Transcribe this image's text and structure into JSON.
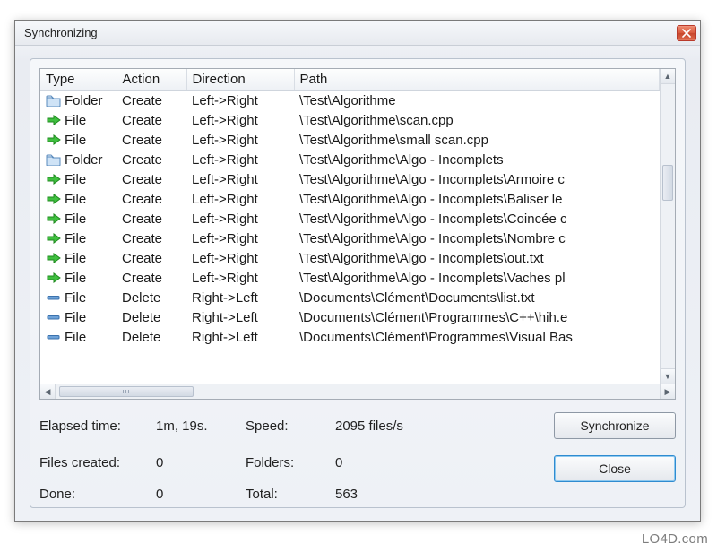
{
  "window": {
    "title": "Synchronizing"
  },
  "columns": {
    "type": "Type",
    "action": "Action",
    "direction": "Direction",
    "path": "Path"
  },
  "rows": [
    {
      "icon": "folder",
      "type": "Folder",
      "action": "Create",
      "direction": "Left->Right",
      "path": "\\Test\\Algorithme"
    },
    {
      "icon": "arrow-right",
      "type": "File",
      "action": "Create",
      "direction": "Left->Right",
      "path": "\\Test\\Algorithme\\scan.cpp"
    },
    {
      "icon": "arrow-right",
      "type": "File",
      "action": "Create",
      "direction": "Left->Right",
      "path": "\\Test\\Algorithme\\small scan.cpp"
    },
    {
      "icon": "folder",
      "type": "Folder",
      "action": "Create",
      "direction": "Left->Right",
      "path": "\\Test\\Algorithme\\Algo - Incomplets"
    },
    {
      "icon": "arrow-right",
      "type": "File",
      "action": "Create",
      "direction": "Left->Right",
      "path": "\\Test\\Algorithme\\Algo - Incomplets\\Armoire c"
    },
    {
      "icon": "arrow-right",
      "type": "File",
      "action": "Create",
      "direction": "Left->Right",
      "path": "\\Test\\Algorithme\\Algo - Incomplets\\Baliser le"
    },
    {
      "icon": "arrow-right",
      "type": "File",
      "action": "Create",
      "direction": "Left->Right",
      "path": "\\Test\\Algorithme\\Algo - Incomplets\\Coincée c"
    },
    {
      "icon": "arrow-right",
      "type": "File",
      "action": "Create",
      "direction": "Left->Right",
      "path": "\\Test\\Algorithme\\Algo - Incomplets\\Nombre c"
    },
    {
      "icon": "arrow-right",
      "type": "File",
      "action": "Create",
      "direction": "Left->Right",
      "path": "\\Test\\Algorithme\\Algo - Incomplets\\out.txt"
    },
    {
      "icon": "arrow-right",
      "type": "File",
      "action": "Create",
      "direction": "Left->Right",
      "path": "\\Test\\Algorithme\\Algo - Incomplets\\Vaches pl"
    },
    {
      "icon": "minus",
      "type": "File",
      "action": "Delete",
      "direction": "Right->Left",
      "path": "\\Documents\\Clément\\Documents\\list.txt"
    },
    {
      "icon": "minus",
      "type": "File",
      "action": "Delete",
      "direction": "Right->Left",
      "path": "\\Documents\\Clément\\Programmes\\C++\\hih.e"
    },
    {
      "icon": "minus",
      "type": "File",
      "action": "Delete",
      "direction": "Right->Left",
      "path": "\\Documents\\Clément\\Programmes\\Visual Bas"
    }
  ],
  "stats": {
    "elapsed_label": "Elapsed time:",
    "elapsed_value": "1m, 19s.",
    "speed_label": "Speed:",
    "speed_value": "2095 files/s",
    "files_created_label": "Files created:",
    "files_created_value": "0",
    "folders_label": "Folders:",
    "folders_value": "0",
    "done_label": "Done:",
    "done_value": "0",
    "total_label": "Total:",
    "total_value": "563"
  },
  "buttons": {
    "synchronize": "Synchronize",
    "close": "Close"
  },
  "watermark": "LO4D.com"
}
